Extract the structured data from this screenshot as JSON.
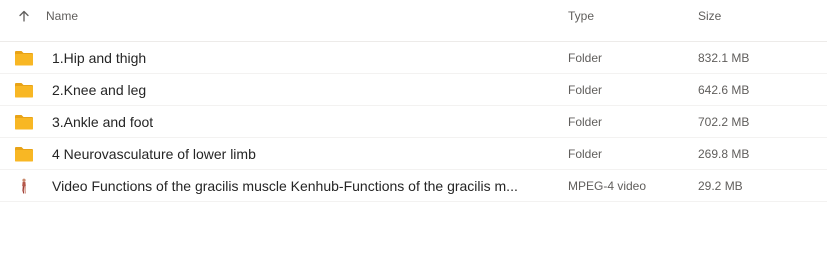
{
  "header": {
    "sort_icon": "arrow-up-icon",
    "name_label": "Name",
    "type_label": "Type",
    "size_label": "Size"
  },
  "colors": {
    "folder": "#f8b724",
    "folder_dark": "#e8a317",
    "text": "#252525",
    "muted": "#605e5c",
    "divider": "#edebe9"
  },
  "rows": [
    {
      "icon": "folder-icon",
      "name": "1.Hip and thigh",
      "type": "Folder",
      "size": "832.1 MB"
    },
    {
      "icon": "folder-icon",
      "name": "2.Knee and leg",
      "type": "Folder",
      "size": "642.6 MB"
    },
    {
      "icon": "folder-icon",
      "name": "3.Ankle and foot",
      "type": "Folder",
      "size": "702.2 MB"
    },
    {
      "icon": "folder-icon",
      "name": "4 Neurovasculature of lower limb",
      "type": "Folder",
      "size": "269.8 MB"
    },
    {
      "icon": "video-thumbnail-icon",
      "name": "Video Functions of the gracilis muscle Kenhub-Functions of the gracilis m...",
      "type": "MPEG-4 video",
      "size": "29.2 MB"
    }
  ]
}
